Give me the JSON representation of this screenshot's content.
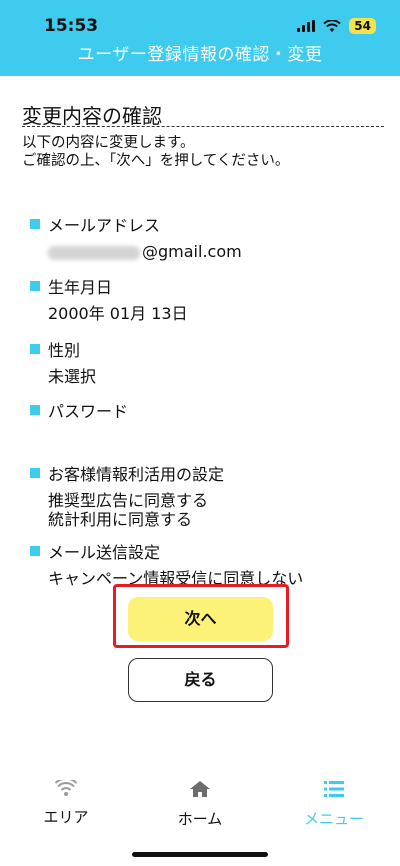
{
  "status_bar": {
    "time": "15:53",
    "battery": "54"
  },
  "header": {
    "title": "ユーザー登録情報の確認・変更"
  },
  "page": {
    "title": "変更内容の確認",
    "intro_line1": "以下の内容に変更します。",
    "intro_line2": "ご確認の上、「次へ」を押してください。"
  },
  "sections": {
    "email": {
      "label": "メールアドレス",
      "value_suffix": "@gmail.com"
    },
    "birthdate": {
      "label": "生年月日",
      "value": "2000年 01月 13日"
    },
    "gender": {
      "label": "性別",
      "value": "未選択"
    },
    "password": {
      "label": "パスワード"
    },
    "customer_info": {
      "label": "お客様情報利活用の設定",
      "line1": "推奨型広告に同意する",
      "line2": "統計利用に同意する"
    },
    "mail_settings": {
      "label": "メール送信設定",
      "value": "キャンペーン情報受信に同意しない"
    }
  },
  "buttons": {
    "next": "次へ",
    "back": "戻る"
  },
  "tabbar": {
    "area": "エリア",
    "home": "ホーム",
    "menu": "メニュー",
    "active_color": "#3ecbee"
  },
  "colors": {
    "header_bg": "#3ecbee",
    "next_button_bg": "#fcf278",
    "highlight_border": "#e51c23"
  },
  "icons": [
    "signal-icon",
    "wifi-icon",
    "battery-icon",
    "wifi-area-icon",
    "home-icon",
    "menu-list-icon"
  ]
}
